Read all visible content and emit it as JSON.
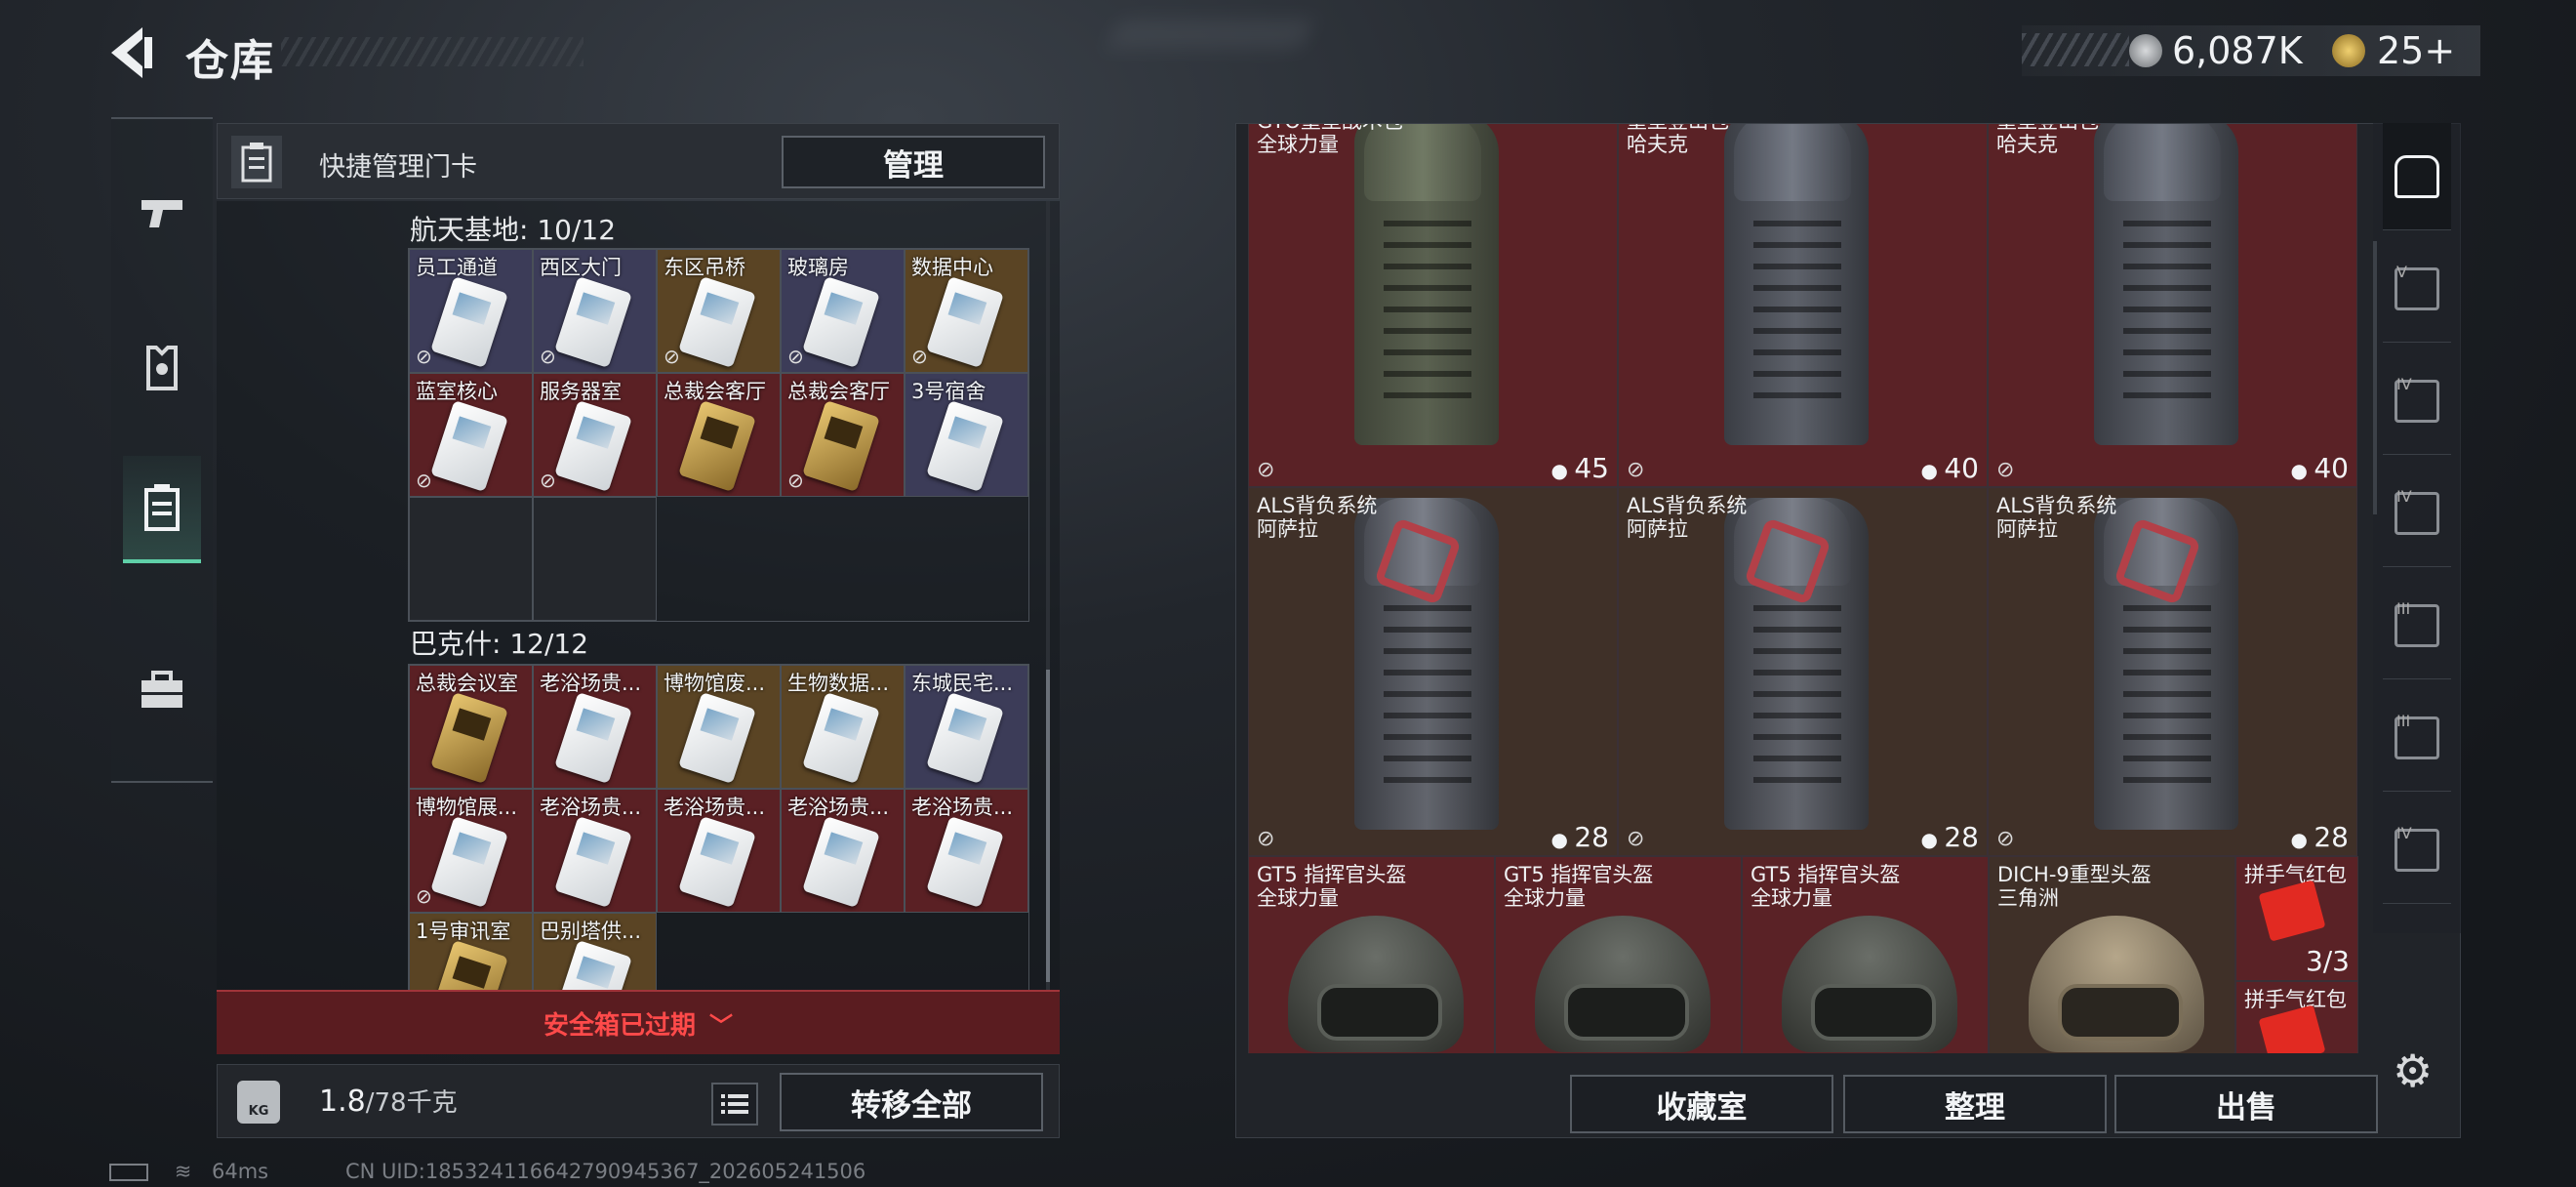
{
  "header": {
    "title": "仓库"
  },
  "currency": {
    "coins": "6,087K",
    "tickets": "25+"
  },
  "left_panel": {
    "quick_label": "快捷管理门卡",
    "manage_button": "管理",
    "groups": [
      {
        "title": "航天基地: 10/12",
        "cards": [
          {
            "name": "员工通道",
            "color": "purple",
            "gold": false,
            "locked": true
          },
          {
            "name": "西区大门",
            "color": "purple",
            "gold": false,
            "locked": true
          },
          {
            "name": "东区吊桥",
            "color": "gold",
            "gold": false,
            "locked": true
          },
          {
            "name": "玻璃房",
            "color": "purple",
            "gold": false,
            "locked": true
          },
          {
            "name": "数据中心",
            "color": "gold",
            "gold": false,
            "locked": true
          },
          {
            "name": "蓝室核心",
            "color": "red",
            "gold": false,
            "locked": true
          },
          {
            "name": "服务器室",
            "color": "red",
            "gold": false,
            "locked": true
          },
          {
            "name": "总裁会客厅",
            "color": "red",
            "gold": true,
            "locked": false
          },
          {
            "name": "总裁会客厅",
            "color": "red",
            "gold": true,
            "locked": true
          },
          {
            "name": "3号宿舍",
            "color": "purple",
            "gold": false,
            "locked": false
          },
          {
            "name": "",
            "color": "empty",
            "gold": false,
            "locked": false
          },
          {
            "name": "",
            "color": "empty",
            "gold": false,
            "locked": false
          }
        ]
      },
      {
        "title": "巴克什: 12/12",
        "cards": [
          {
            "name": "总裁会议室",
            "color": "red",
            "gold": true,
            "locked": false
          },
          {
            "name": "老浴场贵...",
            "color": "red",
            "gold": false,
            "locked": false
          },
          {
            "name": "博物馆废...",
            "color": "gold",
            "gold": false,
            "locked": false
          },
          {
            "name": "生物数据...",
            "color": "gold",
            "gold": false,
            "locked": false
          },
          {
            "name": "东城民宅...",
            "color": "purple",
            "gold": false,
            "locked": false
          },
          {
            "name": "博物馆展...",
            "color": "red",
            "gold": false,
            "locked": true
          },
          {
            "name": "老浴场贵...",
            "color": "red",
            "gold": false,
            "locked": false
          },
          {
            "name": "老浴场贵...",
            "color": "red",
            "gold": false,
            "locked": false
          },
          {
            "name": "老浴场贵...",
            "color": "red",
            "gold": false,
            "locked": false
          },
          {
            "name": "老浴场贵...",
            "color": "red",
            "gold": false,
            "locked": false
          },
          {
            "name": "1号审讯室",
            "color": "gold",
            "gold": true,
            "locked": false
          },
          {
            "name": "巴别塔供...",
            "color": "gold",
            "gold": false,
            "locked": false
          }
        ]
      }
    ],
    "expired_notice": "安全箱已过期",
    "weight_value": "1.8",
    "weight_max": "/78千克",
    "transfer_button": "转移全部"
  },
  "inventory": {
    "bags": [
      {
        "line1": "GTO重型战术包",
        "line2": "全球力量",
        "capacity": "45",
        "style": "olive",
        "bg": "red"
      },
      {
        "line1": "重型登山包",
        "line2": "哈夫克",
        "capacity": "40",
        "style": "grey",
        "bg": "red"
      },
      {
        "line1": "重型登山包",
        "line2": "哈夫克",
        "capacity": "40",
        "style": "grey",
        "bg": "red"
      },
      {
        "line1": "ALS背负系统",
        "line2": "阿萨拉",
        "capacity": "28",
        "style": "als",
        "bg": "brown"
      },
      {
        "line1": "ALS背负系统",
        "line2": "阿萨拉",
        "capacity": "28",
        "style": "als",
        "bg": "brown"
      },
      {
        "line1": "ALS背负系统",
        "line2": "阿萨拉",
        "capacity": "28",
        "style": "als",
        "bg": "brown"
      }
    ],
    "helmets": [
      {
        "line1": "GT5 指挥官头盔",
        "line2": "全球力量",
        "style": "dark"
      },
      {
        "line1": "GT5 指挥官头盔",
        "line2": "全球力量",
        "style": "dark"
      },
      {
        "line1": "GT5 指挥官头盔",
        "line2": "全球力量",
        "style": "dark"
      },
      {
        "line1": "DICH-9重型头盔",
        "line2": "三角洲",
        "style": "tan"
      }
    ],
    "small_items": [
      {
        "name": "拼手气红包",
        "count": "3/3"
      },
      {
        "name": "拼手气红包",
        "count": ""
      }
    ]
  },
  "bottom_buttons": {
    "collection": "收藏室",
    "organize": "整理",
    "sell": "出售"
  },
  "right_nav": [
    {
      "icon": "backpack-slot-icon",
      "tier": ""
    },
    {
      "icon": "armor-slot-icon",
      "tier": "V"
    },
    {
      "icon": "medkit-slot-icon",
      "tier": "IV"
    },
    {
      "icon": "folder-slot-icon",
      "tier": "IV"
    },
    {
      "icon": "warning-slot-icon",
      "tier": "III"
    },
    {
      "icon": "weapon-slot-icon",
      "tier": "III"
    },
    {
      "icon": "misc-slot-icon",
      "tier": "IV"
    }
  ],
  "status": {
    "ping": "64ms",
    "uid": "CN UID:18532411664279094536​7_202605241506"
  },
  "colors": {
    "accent": "#5fd0a8",
    "warning": "#ff4a4a"
  }
}
